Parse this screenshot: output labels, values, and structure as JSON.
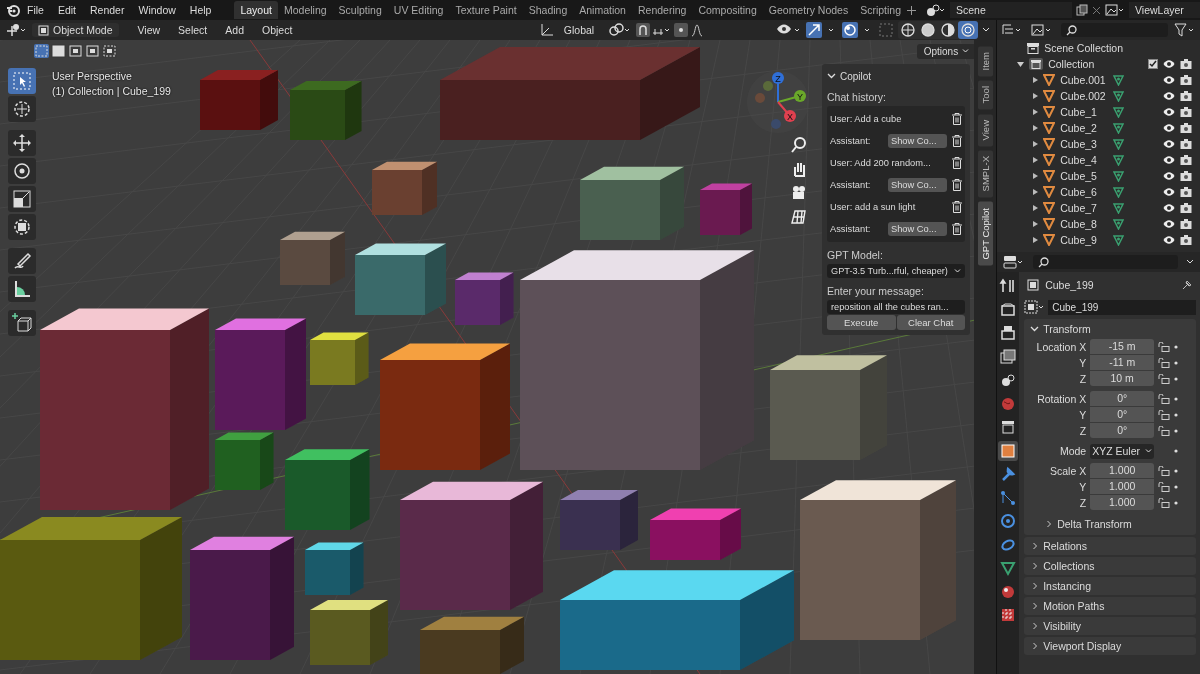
{
  "menu": [
    "File",
    "Edit",
    "Render",
    "Window",
    "Help"
  ],
  "workspaces": [
    {
      "label": "Layout",
      "selected": true
    },
    {
      "label": "Modeling",
      "selected": false
    },
    {
      "label": "Sculpting",
      "selected": false
    },
    {
      "label": "UV Editing",
      "selected": false
    },
    {
      "label": "Texture Paint",
      "selected": false
    },
    {
      "label": "Shading",
      "selected": false
    },
    {
      "label": "Animation",
      "selected": false
    },
    {
      "label": "Rendering",
      "selected": false
    },
    {
      "label": "Compositing",
      "selected": false
    },
    {
      "label": "Geometry Nodes",
      "selected": false
    },
    {
      "label": "Scripting",
      "selected": false
    }
  ],
  "scene": "Scene",
  "view_layer": "ViewLayer",
  "viewport": {
    "mode": "Object Mode",
    "menus": [
      "View",
      "Select",
      "Add",
      "Object"
    ],
    "orientation": "Global",
    "options": "Options",
    "select_modes": [
      {
        "selected": true
      },
      {
        "selected": false
      },
      {
        "selected": false
      },
      {
        "selected": false
      },
      {
        "selected": false
      }
    ],
    "shading": [
      {
        "selected": false
      },
      {
        "selected": false
      },
      {
        "selected": false
      },
      {
        "selected": true
      }
    ],
    "overlay_lines": [
      "User Perspective",
      "(1) Collection | Cube_199"
    ],
    "tools": [
      {
        "kind": "select",
        "selected": true
      },
      {
        "kind": "cursor",
        "selected": false
      },
      {
        "kind": "move",
        "selected": false
      },
      {
        "kind": "rotate",
        "selected": false
      },
      {
        "kind": "scale",
        "selected": false
      },
      {
        "kind": "transform",
        "selected": false
      },
      {
        "kind": "annotate",
        "selected": false
      },
      {
        "kind": "measure",
        "selected": false
      },
      {
        "kind": "add-cube",
        "selected": false
      }
    ],
    "gizmo_axes": [
      {
        "label": "Z",
        "color": "#2f6fd8"
      },
      {
        "label": "Y",
        "color": "#6aa82a"
      },
      {
        "label": "X",
        "color": "#e0404f"
      }
    ]
  },
  "sidebar_tabs": [
    {
      "label": "Item",
      "selected": false
    },
    {
      "label": "Tool",
      "selected": false
    },
    {
      "label": "View",
      "selected": false
    },
    {
      "label": "SMPL-X",
      "selected": false
    },
    {
      "label": "GPT Copilot",
      "selected": true
    }
  ],
  "copilot": {
    "title": "Copilot",
    "expanded": true,
    "history_label": "Chat history:",
    "history": [
      {
        "kind": "user",
        "text": "User: Add a cube"
      },
      {
        "kind": "assistant",
        "text": "Assistant:",
        "button": "Show Co..."
      },
      {
        "kind": "user",
        "text": "User: Add 200 random..."
      },
      {
        "kind": "assistant",
        "text": "Assistant:",
        "button": "Show Co..."
      },
      {
        "kind": "user",
        "text": "User: add a sun light"
      },
      {
        "kind": "assistant",
        "text": "Assistant:",
        "button": "Show Co..."
      }
    ],
    "model_label": "GPT Model:",
    "model": "GPT-3.5 Turb...rful, cheaper)",
    "message_label": "Enter your message:",
    "message": "reposition all the cubes ran...",
    "buttons": [
      "Execute",
      "Clear Chat"
    ]
  },
  "outliner": {
    "root": "Scene Collection",
    "collection": {
      "name": "Collection",
      "expanded": true,
      "checked": true,
      "children": [
        {
          "name": "Cube.001"
        },
        {
          "name": "Cube.002"
        },
        {
          "name": "Cube_1"
        },
        {
          "name": "Cube_2"
        },
        {
          "name": "Cube_3"
        },
        {
          "name": "Cube_4"
        },
        {
          "name": "Cube_5"
        },
        {
          "name": "Cube_6"
        },
        {
          "name": "Cube_7"
        },
        {
          "name": "Cube_8"
        },
        {
          "name": "Cube_9"
        }
      ]
    }
  },
  "properties": {
    "tabs": [
      {
        "kind": "tool",
        "selected": false
      },
      {
        "kind": "render",
        "selected": false
      },
      {
        "kind": "output",
        "selected": false
      },
      {
        "kind": "view-layer",
        "selected": false
      },
      {
        "kind": "scene",
        "selected": false
      },
      {
        "kind": "world",
        "selected": false
      },
      {
        "kind": "collection",
        "selected": false
      },
      {
        "kind": "object",
        "selected": true
      },
      {
        "kind": "modifier",
        "selected": false
      },
      {
        "kind": "particles",
        "selected": false
      },
      {
        "kind": "physics",
        "selected": false
      },
      {
        "kind": "constraints",
        "selected": false
      },
      {
        "kind": "data",
        "selected": false
      },
      {
        "kind": "material",
        "selected": false
      },
      {
        "kind": "texture",
        "selected": false
      }
    ],
    "object": "Cube_199",
    "name_field": "Cube_199",
    "transform": {
      "title": "Transform",
      "expanded": true,
      "groups": [
        {
          "kind": "fields",
          "rows": [
            {
              "label": "Location X",
              "value": "-15 m"
            },
            {
              "label": "Y",
              "value": "-11 m"
            },
            {
              "label": "Z",
              "value": "10 m"
            }
          ]
        },
        {
          "kind": "fields",
          "rows": [
            {
              "label": "Rotation X",
              "value": "0°"
            },
            {
              "label": "Y",
              "value": "0°"
            },
            {
              "label": "Z",
              "value": "0°"
            }
          ]
        },
        {
          "kind": "dropdown",
          "label": "Mode",
          "value": "XYZ Euler"
        },
        {
          "kind": "fields",
          "rows": [
            {
              "label": "Scale X",
              "value": "1.000"
            },
            {
              "label": "Y",
              "value": "1.000"
            },
            {
              "label": "Z",
              "value": "1.000"
            }
          ]
        }
      ],
      "subpanel": "Delta Transform"
    },
    "panels": [
      "Relations",
      "Collections",
      "Instancing",
      "Motion Paths",
      "Visibility",
      "Viewport Display"
    ]
  }
}
